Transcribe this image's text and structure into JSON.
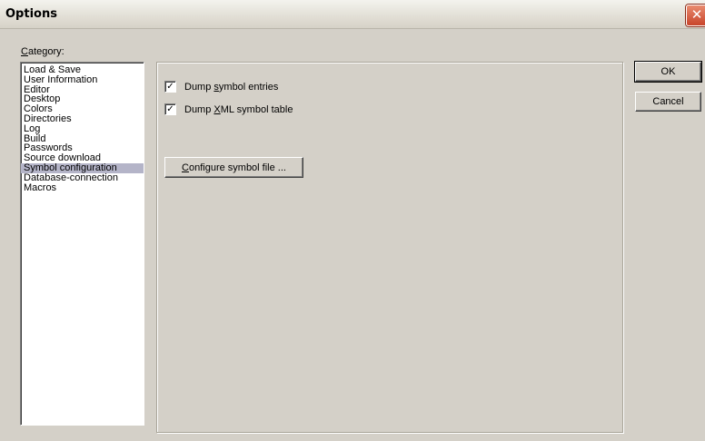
{
  "window": {
    "title": "Options",
    "close_glyph": "✕"
  },
  "category": {
    "label_prefix": "",
    "label_mnemonic": "C",
    "label_rest": "ategory:",
    "items": [
      "Load & Save",
      "User Information",
      "Editor",
      "Desktop",
      "Colors",
      "Directories",
      "Log",
      "Build",
      "Passwords",
      "Source download",
      "Symbol configuration",
      "Database-connection",
      "Macros"
    ],
    "selected": "Symbol configuration"
  },
  "symbol_config": {
    "dump_entries": {
      "checked": true,
      "check_glyph": "✓",
      "label_before": "Dump ",
      "label_mnemonic": "s",
      "label_after": "ymbol entries"
    },
    "dump_xml": {
      "checked": true,
      "check_glyph": "✓",
      "label_before": "Dump ",
      "label_mnemonic": "X",
      "label_after": "ML symbol table"
    },
    "configure_button": {
      "label_mnemonic": "C",
      "label_rest": "onfigure symbol file ..."
    }
  },
  "buttons": {
    "ok": "OK",
    "cancel": "Cancel"
  },
  "colors": {
    "dialog_bg": "#d4d0c8",
    "selection_bg": "#b4b4c8",
    "close_red": "#c8452b"
  }
}
